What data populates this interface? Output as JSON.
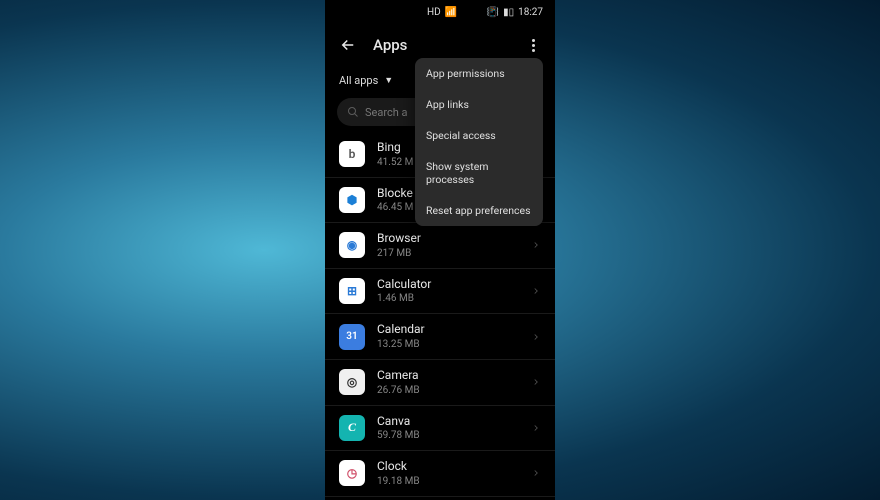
{
  "status": {
    "hd": "HD",
    "time": "18:27"
  },
  "header": {
    "title": "Apps"
  },
  "filter": {
    "label": "All apps"
  },
  "search": {
    "placeholder": "Search a"
  },
  "apps": [
    {
      "name": "Bing",
      "size": "41.52 M",
      "icon": "b",
      "cls": "ic-bing"
    },
    {
      "name": "Blocke",
      "size": "46.45 M",
      "icon": "⬢",
      "cls": "ic-blocked"
    },
    {
      "name": "Browser",
      "size": "217 MB",
      "icon": "◉",
      "cls": "ic-browser"
    },
    {
      "name": "Calculator",
      "size": "1.46 MB",
      "icon": "⊞",
      "cls": "ic-calculator"
    },
    {
      "name": "Calendar",
      "size": "13.25 MB",
      "icon": "31",
      "cls": "ic-calendar"
    },
    {
      "name": "Camera",
      "size": "26.76 MB",
      "icon": "◎",
      "cls": "ic-camera"
    },
    {
      "name": "Canva",
      "size": "59.78 MB",
      "icon": "C",
      "cls": "ic-canva"
    },
    {
      "name": "Clock",
      "size": "19.18 MB",
      "icon": "◷",
      "cls": "ic-clock"
    }
  ],
  "menu": {
    "items": [
      "App permissions",
      "App links",
      "Special access",
      "Show system processes",
      "Reset app preferences"
    ]
  }
}
